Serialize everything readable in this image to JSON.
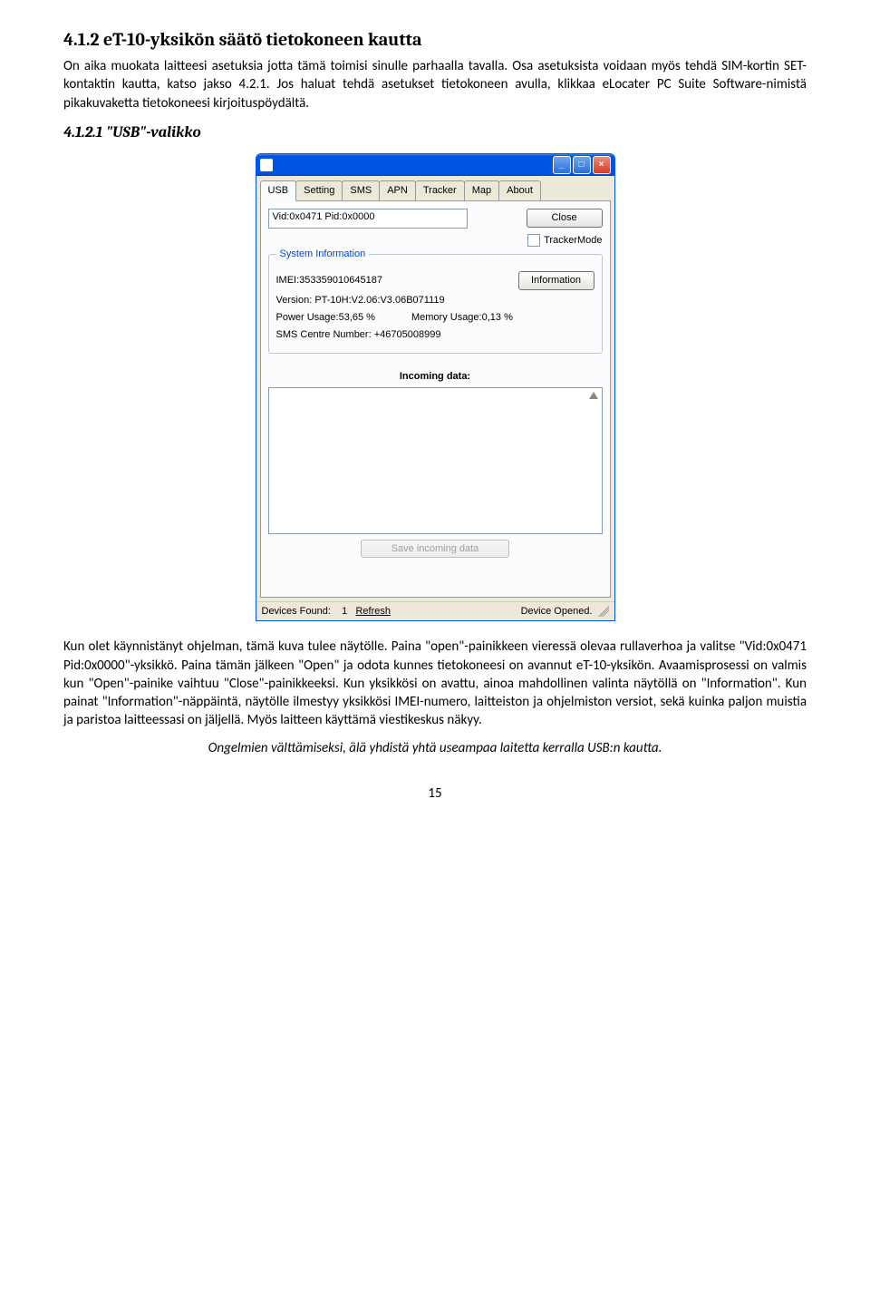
{
  "section": {
    "h2": "4.1.2 eT-10-yksikön säätö tietokoneen kautta",
    "p1": "On aika muokata laitteesi asetuksia jotta tämä toimisi sinulle parhaalla tavalla. Osa asetuksista voidaan myös tehdä SIM-kortin SET-kontaktin kautta, katso jakso 4.2.1. Jos haluat tehdä asetukset tietokoneen avulla, klikkaa eLocater PC Suite Software-nimistä pikakuvaketta tietokoneesi kirjoituspöydältä.",
    "h3": "4.1.2.1 \"USB\"-valikko",
    "p2a": "Kun olet käynnistänyt ohjelman, tämä kuva tulee näytölle. Paina \"open\"-painikkeen vieressä olevaa rullaverhoa ja valitse \"Vid:0x0471 Pid:0x0000\"-yksikkö. Paina tämän jälkeen \"Open\" ja odota kunnes tietokoneesi on avannut eT-10-yksikön. Avaamisprosessi on valmis kun \"Open\"-painike vaihtuu \"Close\"-painikkeeksi. Kun yksikkösi on avattu, ainoa mahdollinen valinta näytöllä on \"Information\". Kun painat \"Information\"-näppäintä, näytölle ilmestyy yksikkösi IMEI-numero, laitteiston ja ohjelmiston versiot, sekä kuinka paljon muistia ja paristoa laitteessasi on jäljellä. Myös laitteen käyttämä viestikeskus näkyy.",
    "note": "Ongelmien välttämiseksi, älä yhdistä yhtä useampaa laitetta kerralla USB:n kautta.",
    "pagenum": "15"
  },
  "win": {
    "tabs": [
      "USB",
      "Setting",
      "SMS",
      "APN",
      "Tracker",
      "Map",
      "About"
    ],
    "vid_value": "Vid:0x0471 Pid:0x0000",
    "close_btn": "Close",
    "tracker_label": "TrackerMode",
    "group_legend": "System Information",
    "imei_label": "IMEI:",
    "imei_value": "353359010645187",
    "info_btn": "Information",
    "version_label": "Version:",
    "version_value": "PT-10H:V2.06:V3.06B071119",
    "power_label": "Power Usage:",
    "power_value": "53,65 %",
    "memory_label": "Memory Usage:",
    "memory_value": "0,13 %",
    "sms_label": "SMS Centre Number:",
    "sms_value": "+46705008999",
    "incoming": "Incoming data:",
    "save_btn": "Save incoming data",
    "status_left_a": "Devices Found:",
    "status_left_b": "1",
    "status_refresh": "Refresh",
    "status_right": "Device Opened."
  }
}
